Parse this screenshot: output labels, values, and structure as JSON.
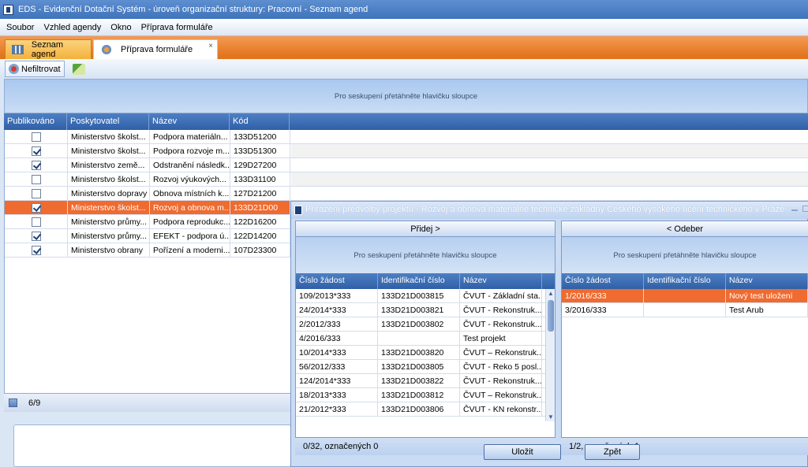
{
  "window": {
    "title": "EDS - Evidenční Dotační Systém - úroveň organizační struktury: Pracovní - Seznam agend"
  },
  "menu": [
    "Soubor",
    "Vzhled agendy",
    "Okno",
    "Příprava formuláře"
  ],
  "doc_tabs": {
    "active": "Seznam agend",
    "inactive": "Příprava formuláře",
    "close": "×"
  },
  "toolbar": {
    "filter_label": "Nefiltrovat"
  },
  "main_grid": {
    "group_hint": "Pro seskupení přetáhněte hlavičku sloupce",
    "columns": [
      "Publikováno",
      "Poskytovatel",
      "Název",
      "Kód"
    ],
    "rows": [
      {
        "published": false,
        "provider": "Ministerstvo školst...",
        "name": "Podpora materiáln...",
        "code": "133D51200",
        "selected": false
      },
      {
        "published": true,
        "provider": "Ministerstvo školst...",
        "name": "Podpora rozvoje m...",
        "code": "133D51300",
        "selected": false
      },
      {
        "published": true,
        "provider": "Ministerstvo země...",
        "name": "Odstranění následk...",
        "code": "129D27200",
        "selected": false
      },
      {
        "published": false,
        "provider": "Ministerstvo školst...",
        "name": "Rozvoj výukových...",
        "code": "133D31100",
        "selected": false
      },
      {
        "published": false,
        "provider": "Ministerstvo dopravy",
        "name": "Obnova místních k...",
        "code": "127D21200",
        "selected": false
      },
      {
        "published": true,
        "provider": "Ministerstvo školst...",
        "name": "Rozvoj a obnova m...",
        "code": "133D21D00",
        "selected": true
      },
      {
        "published": false,
        "provider": "Ministerstvo průmy...",
        "name": "Podpora reprodukc...",
        "code": "122D16200",
        "selected": false
      },
      {
        "published": true,
        "provider": "Ministerstvo průmy...",
        "name": "EFEKT - podpora ú...",
        "code": "122D14200",
        "selected": false
      },
      {
        "published": true,
        "provider": "Ministerstvo obrany",
        "name": "Pořízení a moderni...",
        "code": "107D23300",
        "selected": false
      }
    ],
    "status": "6/9"
  },
  "dialog": {
    "title": "Přiřazení předvolby projektu - Rozvoj a obnova  materiálně technické základny Českého vysokého učení technického v Praze",
    "left": {
      "button": "Přidej  >",
      "group_hint": "Pro seskupení přetáhněte hlavičku sloupce",
      "columns": [
        "Číslo žádost",
        "Identifikační číslo",
        "Název"
      ],
      "rows": [
        [
          "109/2013*333",
          "133D21D003815",
          "ČVUT - Základní sta..."
        ],
        [
          "24/2014*333",
          "133D21D003821",
          "ČVUT - Rekonstruk..."
        ],
        [
          "2/2012/333",
          "133D21D003802",
          "ČVUT - Rekonstruk..."
        ],
        [
          "4/2016/333",
          "",
          "Test projekt"
        ],
        [
          "10/2014*333",
          "133D21D003820",
          "ČVUT – Rekonstruk..."
        ],
        [
          "56/2012/333",
          "133D21D003805",
          "ČVUT - Reko 5 posl..."
        ],
        [
          "124/2014*333",
          "133D21D003822",
          "ČVUT - Rekonstruk..."
        ],
        [
          "18/2013*333",
          "133D21D003812",
          "ČVUT – Rekonstruk..."
        ],
        [
          "21/2012*333",
          "133D21D003806",
          "ČVUT - KN rekonstr..."
        ]
      ],
      "status": "0/32, označených 0"
    },
    "right": {
      "button": "<  Odeber",
      "group_hint": "Pro seskupení přetáhněte hlavičku sloupce",
      "columns": [
        "Číslo žádost",
        "Identifikační číslo",
        "Název"
      ],
      "rows": [
        [
          "1/2016/333",
          "",
          "Nový test uložení"
        ],
        [
          "3/2016/333",
          "",
          "Test Arub"
        ]
      ],
      "status": "1/2, označených 1"
    },
    "save_label": "Uložit",
    "back_label": "Zpět"
  }
}
